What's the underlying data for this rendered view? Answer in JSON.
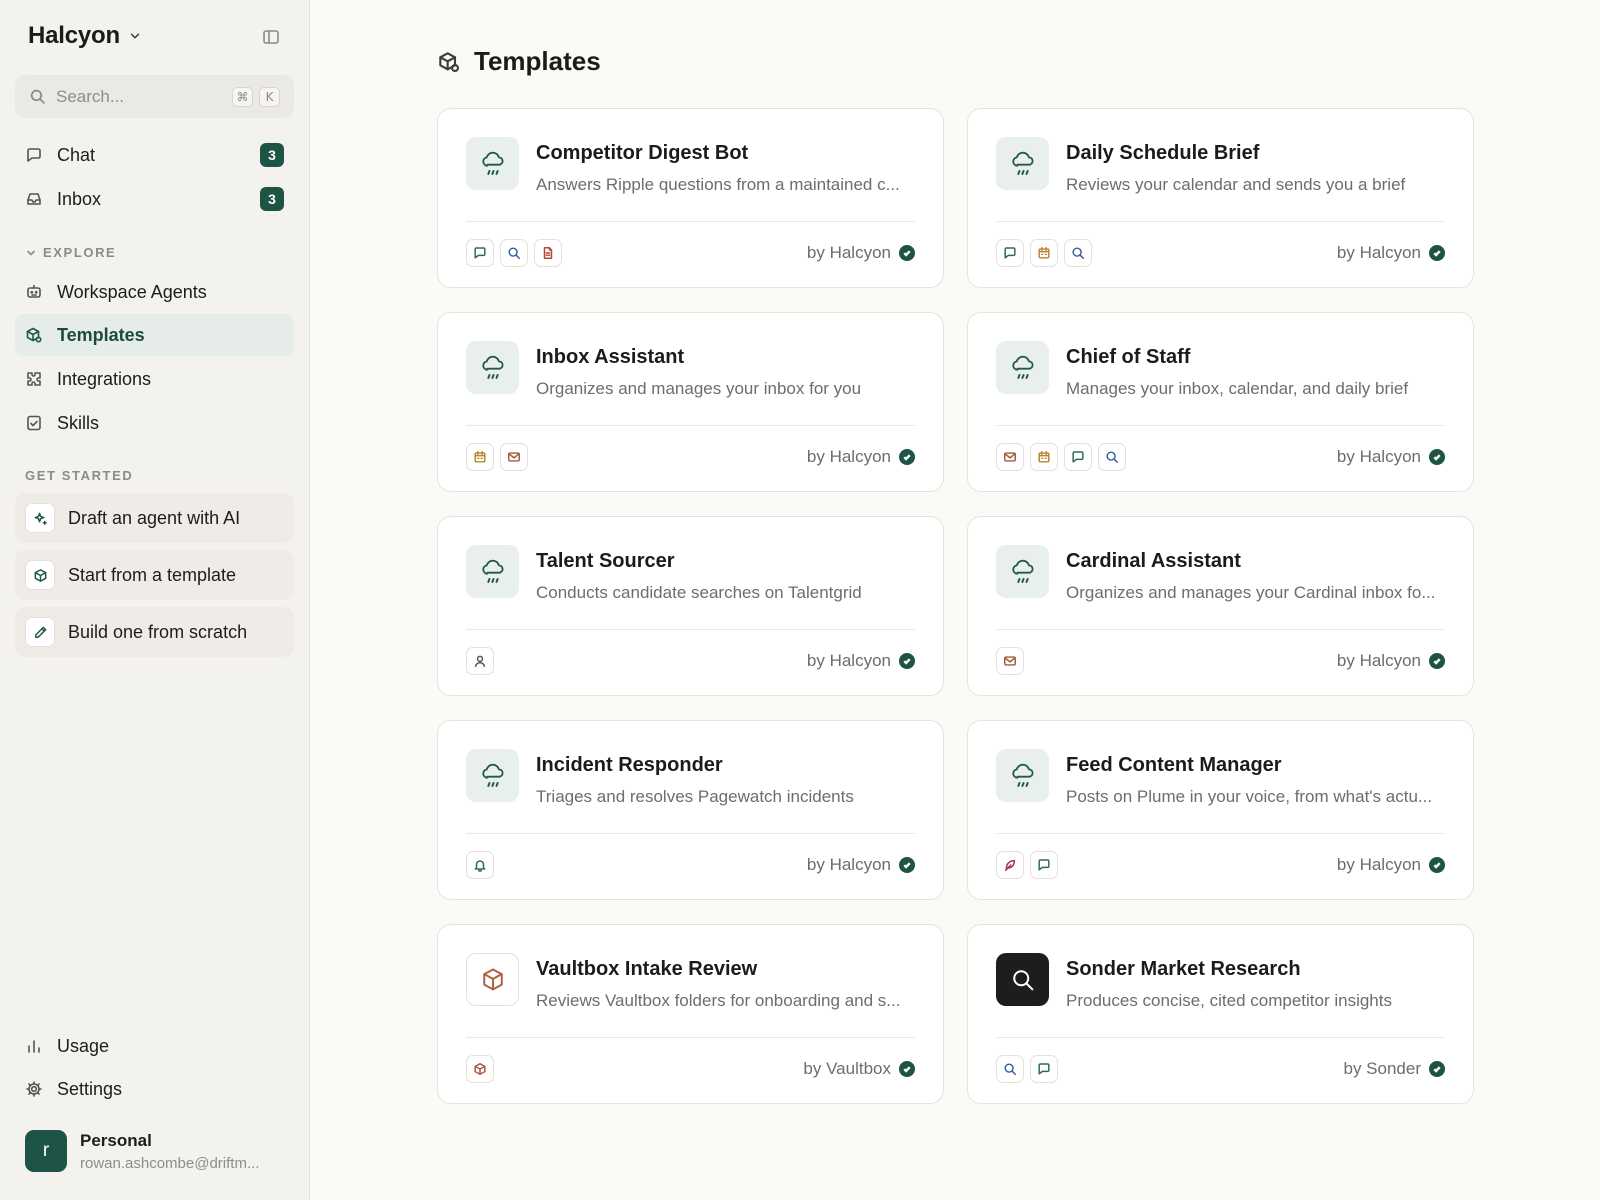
{
  "sidebar": {
    "brand": "Halcyon",
    "search": {
      "placeholder": "Search...",
      "shortcut_mod": "⌘",
      "shortcut_key": "K"
    },
    "main_nav": [
      {
        "label": "Chat",
        "badge": "3",
        "icon": "chat-icon"
      },
      {
        "label": "Inbox",
        "badge": "3",
        "icon": "inbox-icon"
      }
    ],
    "explore": {
      "heading": "EXPLORE",
      "items": [
        {
          "label": "Workspace Agents",
          "icon": "robot-icon"
        },
        {
          "label": "Templates",
          "icon": "templates-icon",
          "active": true
        },
        {
          "label": "Integrations",
          "icon": "puzzle-icon"
        },
        {
          "label": "Skills",
          "icon": "check-square-icon"
        }
      ]
    },
    "get_started": {
      "heading": "GET STARTED",
      "items": [
        {
          "label": "Draft an agent with AI",
          "icon": "sparkle-icon"
        },
        {
          "label": "Start from a template",
          "icon": "box-icon"
        },
        {
          "label": "Build one from scratch",
          "icon": "pencil-icon"
        }
      ]
    },
    "bottom_nav": [
      {
        "label": "Usage",
        "icon": "bar-chart-icon"
      },
      {
        "label": "Settings",
        "icon": "gear-icon"
      }
    ],
    "user": {
      "initial": "r",
      "name": "Personal",
      "email": "rowan.ashcombe@driftm..."
    }
  },
  "main": {
    "title": "Templates",
    "cards": [
      {
        "title": "Competitor Digest Bot",
        "description": "Answers Ripple questions from a maintained c...",
        "author": "by Halcyon",
        "icon": "cloud-rain-icon",
        "tools": [
          "chat",
          "search",
          "document"
        ]
      },
      {
        "title": "Daily Schedule Brief",
        "description": "Reviews your calendar and sends you a brief",
        "author": "by Halcyon",
        "icon": "cloud-rain-icon",
        "tools": [
          "chat",
          "calendar",
          "search"
        ]
      },
      {
        "title": "Inbox Assistant",
        "description": "Organizes and manages your inbox for you",
        "author": "by Halcyon",
        "icon": "cloud-rain-icon",
        "tools": [
          "calendar",
          "mail"
        ]
      },
      {
        "title": "Chief of Staff",
        "description": "Manages your inbox, calendar, and daily brief",
        "author": "by Halcyon",
        "icon": "cloud-rain-icon",
        "tools": [
          "mail",
          "calendar",
          "chat",
          "search"
        ]
      },
      {
        "title": "Talent Sourcer",
        "description": "Conducts candidate searches on Talentgrid",
        "author": "by Halcyon",
        "icon": "cloud-rain-icon",
        "tools": [
          "person"
        ]
      },
      {
        "title": "Cardinal Assistant",
        "description": "Organizes and manages your Cardinal inbox fo...",
        "author": "by Halcyon",
        "icon": "cloud-rain-icon",
        "tools": [
          "mail"
        ]
      },
      {
        "title": "Incident Responder",
        "description": "Triages and resolves Pagewatch incidents",
        "author": "by Halcyon",
        "icon": "cloud-rain-icon",
        "tools": [
          "bell"
        ]
      },
      {
        "title": "Feed Content Manager",
        "description": "Posts on Plume in your voice, from what's actu...",
        "author": "by Halcyon",
        "icon": "cloud-rain-icon",
        "tools": [
          "feather",
          "chat"
        ]
      },
      {
        "title": "Vaultbox Intake Review",
        "description": "Reviews Vaultbox folders for onboarding and s...",
        "author": "by Vaultbox",
        "icon": "box-icon",
        "tools": [
          "box"
        ]
      },
      {
        "title": "Sonder Market Research",
        "description": "Produces concise, cited competitor insights",
        "author": "by Sonder",
        "icon": "search-icon",
        "tools": [
          "search",
          "chat"
        ]
      }
    ]
  }
}
